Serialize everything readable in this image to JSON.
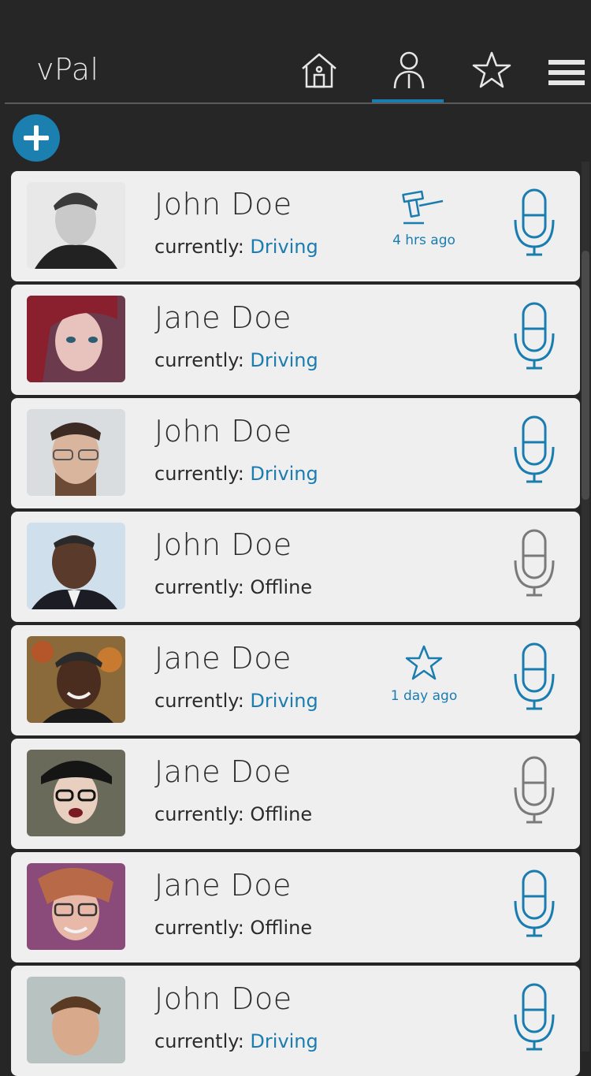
{
  "app": {
    "title": "vPal"
  },
  "nav": {
    "home_icon": "home-icon",
    "contacts_icon": "person-icon",
    "favorites_icon": "star-icon",
    "menu_icon": "hamburger-menu-icon",
    "active_tab": "contacts"
  },
  "colors": {
    "accent": "#1a7db0",
    "offline": "#7a7a7a",
    "background": "#262626",
    "card": "#efefef"
  },
  "contacts": [
    {
      "name": "John Doe",
      "status_prefix": "currently: ",
      "status": "Driving",
      "online": true,
      "activity_icon": "gavel-icon",
      "activity_ago": "4 hrs ago"
    },
    {
      "name": "Jane Doe",
      "status_prefix": "currently: ",
      "status": "Driving",
      "online": true
    },
    {
      "name": "John Doe",
      "status_prefix": "currently: ",
      "status": "Driving",
      "online": true
    },
    {
      "name": "John Doe",
      "status_prefix": "currently: ",
      "status": "Offline",
      "online": false
    },
    {
      "name": "Jane Doe",
      "status_prefix": "currently: ",
      "status": "Driving",
      "online": true,
      "activity_icon": "star-icon",
      "activity_ago": "1 day ago"
    },
    {
      "name": "Jane Doe",
      "status_prefix": "currently: ",
      "status": "Offline",
      "online": false
    },
    {
      "name": "Jane Doe",
      "status_prefix": "currently: ",
      "status": "Offline",
      "online": true
    },
    {
      "name": "John Doe",
      "status_prefix": "currently: ",
      "status": "Driving",
      "online": true
    }
  ]
}
